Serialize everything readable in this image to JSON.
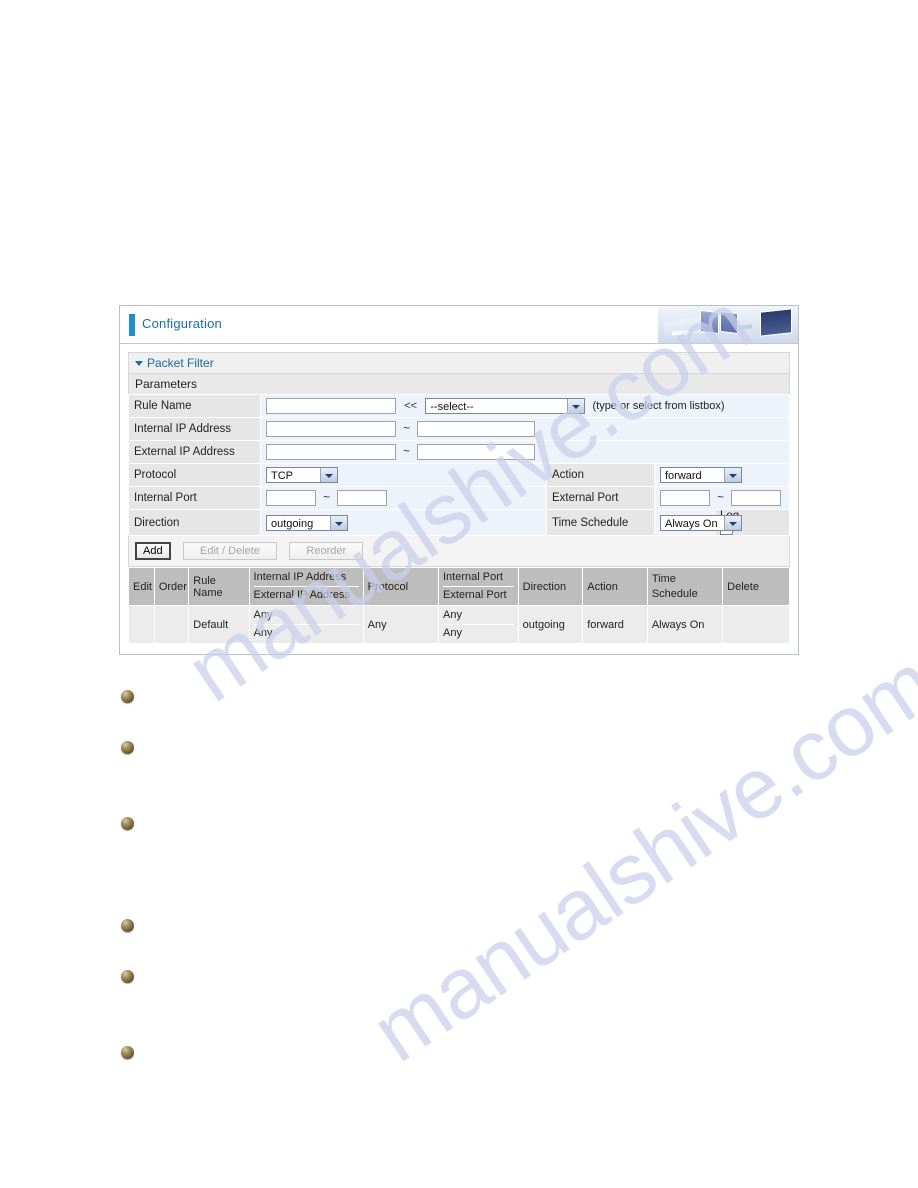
{
  "page": {
    "watermark": "manualshive.com"
  },
  "header": {
    "title": "Configuration",
    "accent_color": "#1f8fd0",
    "banner_icon": "office-monitors-image"
  },
  "section": {
    "title": "Packet Filter",
    "parameters_label": "Parameters"
  },
  "form": {
    "rule_name": {
      "label": "Rule Name",
      "value": "",
      "placeholder": "",
      "double_arrow": "<<",
      "select_value": "--select--",
      "hint": "(type or select from listbox)"
    },
    "internal_ip": {
      "label": "Internal IP Address",
      "from": "",
      "to": "",
      "separator": "~"
    },
    "external_ip": {
      "label": "External IP Address",
      "from": "",
      "to": "",
      "separator": "~"
    },
    "protocol": {
      "label": "Protocol",
      "value": "TCP"
    },
    "action": {
      "label": "Action",
      "value": "forward"
    },
    "internal_port": {
      "label": "Internal Port",
      "from": "",
      "to": "",
      "separator": "~"
    },
    "external_port": {
      "label": "External Port",
      "from": "",
      "to": "",
      "separator": "~"
    },
    "direction": {
      "label": "Direction",
      "value": "outgoing"
    },
    "time_schedule": {
      "label": "Time Schedule",
      "value": "Always On"
    },
    "log": {
      "label": "Log",
      "checked": false
    }
  },
  "buttons": {
    "add": "Add",
    "edit_delete": "Edit / Delete",
    "reorder": "Reorder"
  },
  "grid": {
    "headers": {
      "edit": "Edit",
      "order": "Order",
      "rule_name": "Rule Name",
      "internal_ip": "Internal IP Address",
      "external_ip": "External IP Address",
      "protocol": "Protocol",
      "internal_port": "Internal Port",
      "external_port": "External Port",
      "direction": "Direction",
      "action": "Action",
      "time_schedule_1": "Time",
      "time_schedule_2": "Schedule",
      "delete": "Delete"
    },
    "rows": [
      {
        "edit": "",
        "order": "",
        "rule_name": "Default",
        "internal_ip": "Any",
        "external_ip": "Any",
        "protocol": "Any",
        "internal_port": "Any",
        "external_port": "Any",
        "direction": "outgoing",
        "action": "forward",
        "time_schedule": "Always On",
        "delete": ""
      }
    ]
  },
  "bullets": [
    {
      "name": "bullet-1"
    },
    {
      "name": "bullet-2"
    },
    {
      "name": "bullet-3"
    },
    {
      "name": "bullet-4"
    },
    {
      "name": "bullet-5"
    },
    {
      "name": "bullet-6"
    }
  ]
}
